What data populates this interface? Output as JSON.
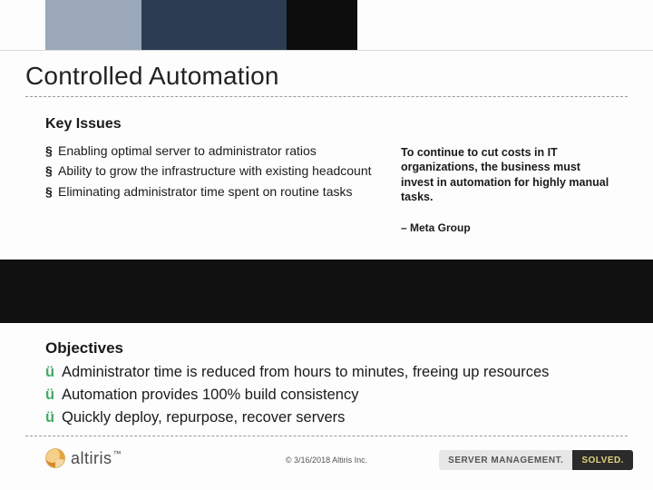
{
  "title": "Controlled Automation",
  "key_issues_heading": "Key Issues",
  "bullet_char": "§",
  "issues": [
    "Enabling optimal server to administrator ratios",
    "Ability to grow the infrastructure with existing headcount",
    "Eliminating administrator time spent on routine tasks"
  ],
  "quote": "To continue to cut costs in IT organizations, the business must invest in automation for highly manual tasks.",
  "quote_attribution": "– Meta Group",
  "objectives_heading": "Objectives",
  "check_char": "ü",
  "objectives": [
    "Administrator time is reduced from hours to minutes, freeing up resources",
    "Automation provides 100% build consistency",
    "Quickly deploy, repurpose, recover servers"
  ],
  "logo_text": "altiris",
  "tm": "™",
  "copyright": "© 3/16/2018 Altiris Inc.",
  "pill_left": "SERVER MANAGEMENT.",
  "pill_right": "SOLVED."
}
